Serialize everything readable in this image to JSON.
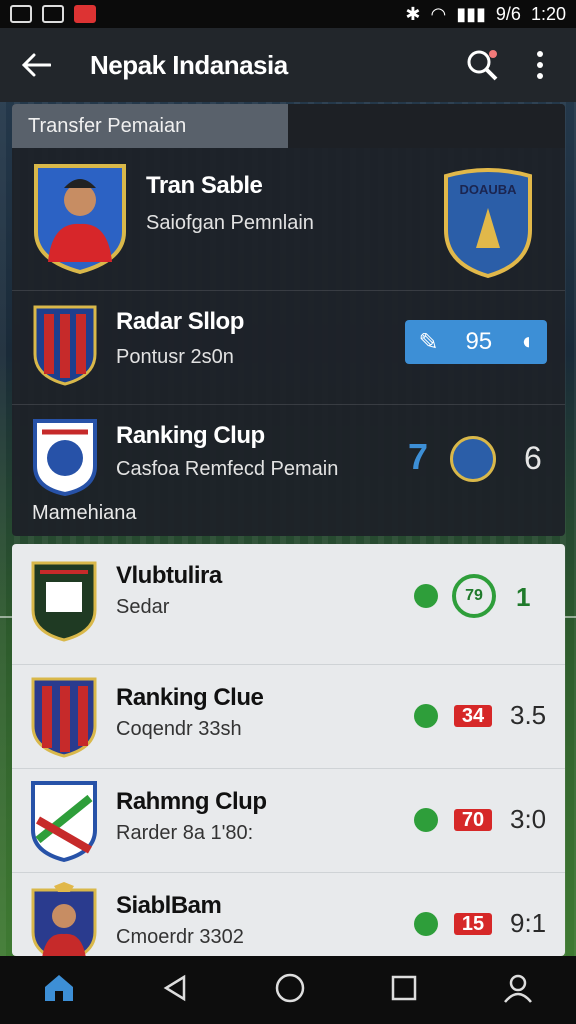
{
  "status": {
    "left_icons": [
      "gallery-icon",
      "photo-icon",
      "alert-icon"
    ],
    "right_text": "1:20",
    "signal_text": "9/6"
  },
  "appbar": {
    "title": "Nepak Indanasia"
  },
  "panel": {
    "tab_label": "Transfer Pemaian",
    "rows": [
      {
        "name": "Tran Sable",
        "sub": "Saiofgan Pemnlain",
        "right_badge_text": "DOAUBA"
      },
      {
        "name": "Radar Sllop",
        "sub": "Pontusr 2s0n",
        "chip_value": "95"
      },
      {
        "name": "Ranking Clup",
        "sub": "Casfoa Remfecd Pemain",
        "left_score": "7",
        "right_score": "6"
      }
    ],
    "footer_text": "Mamehiana"
  },
  "list": [
    {
      "name": "Vlubtulira",
      "sub": "Sedar",
      "badge": "79",
      "score": "1"
    },
    {
      "name": "Ranking Clue",
      "sub": "Coqendr 33sh",
      "badge": "34",
      "score": "3.5"
    },
    {
      "name": "Rahmng Clup",
      "sub": "Rarder 8a 1'80:",
      "badge": "70",
      "score": "3:0"
    },
    {
      "name": "SiablBam",
      "sub": "Cmoerdr 3302",
      "badge": "15",
      "score": "9:1"
    }
  ],
  "colors": {
    "accent": "#3d8fd6",
    "win_green": "#2e9e3a",
    "loss_red": "#d62828"
  }
}
